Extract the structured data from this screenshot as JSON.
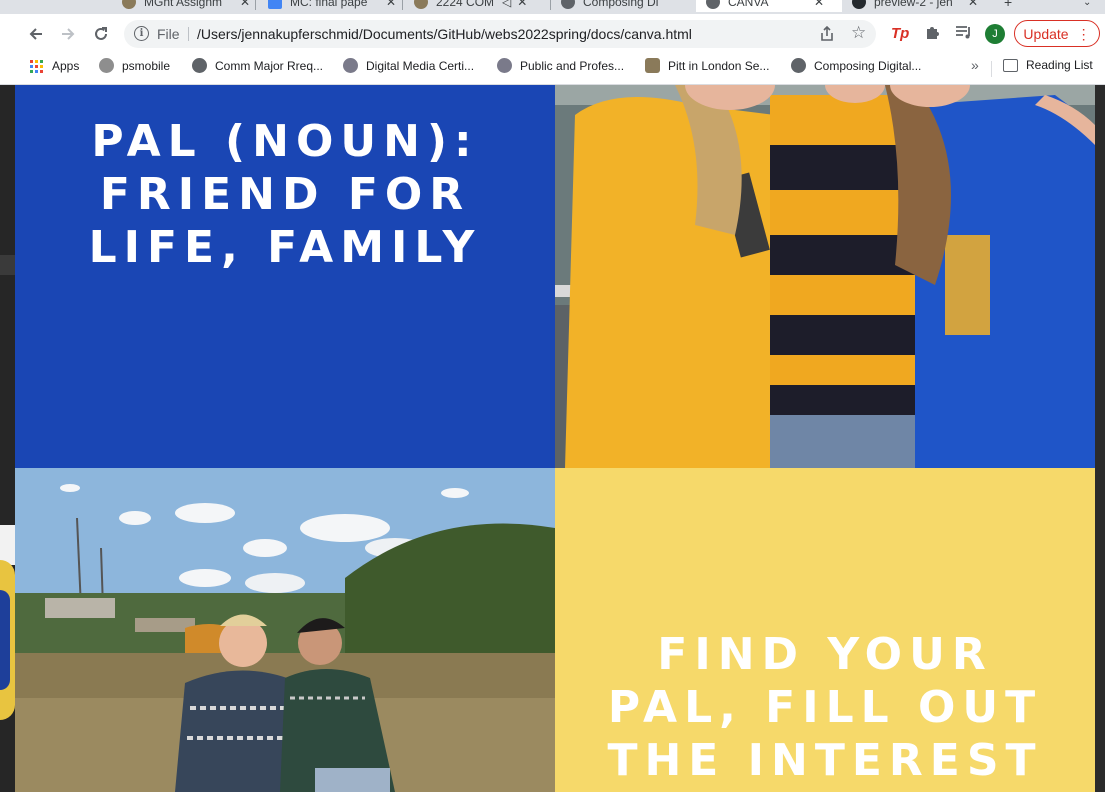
{
  "tabs": [
    {
      "title": "MGnt Assignm"
    },
    {
      "title": "MC: final pape"
    },
    {
      "title": "2224 COM"
    },
    {
      "title": "Composing Di"
    },
    {
      "title": "CANVA"
    },
    {
      "title": "preview-2 - jen"
    }
  ],
  "toolbar": {
    "scheme_label": "File",
    "url": "/Users/jennakupferschmid/Documents/GitHub/webs2022spring/docs/canva.html",
    "avatar_letter": "J",
    "update_label": "Update"
  },
  "bookmarks": {
    "items": [
      {
        "label": "Apps"
      },
      {
        "label": "psmobile"
      },
      {
        "label": "Comm Major Rreq..."
      },
      {
        "label": "Digital Media Certi..."
      },
      {
        "label": "Public and Profes..."
      },
      {
        "label": "Pitt in London Se..."
      },
      {
        "label": "Composing Digital..."
      }
    ],
    "more": "»",
    "reading_list": "Reading List"
  },
  "page": {
    "headline_lines": [
      "PAL (NOUN):",
      "FRIEND FOR",
      "LIFE, FAMILY"
    ],
    "cta_lines": [
      "FIND YOUR",
      "PAL, FILL OUT",
      "THE INTEREST"
    ]
  },
  "colors": {
    "blue": "#1a46b4",
    "yellow": "#f6d96a",
    "update_red": "#d93025"
  }
}
